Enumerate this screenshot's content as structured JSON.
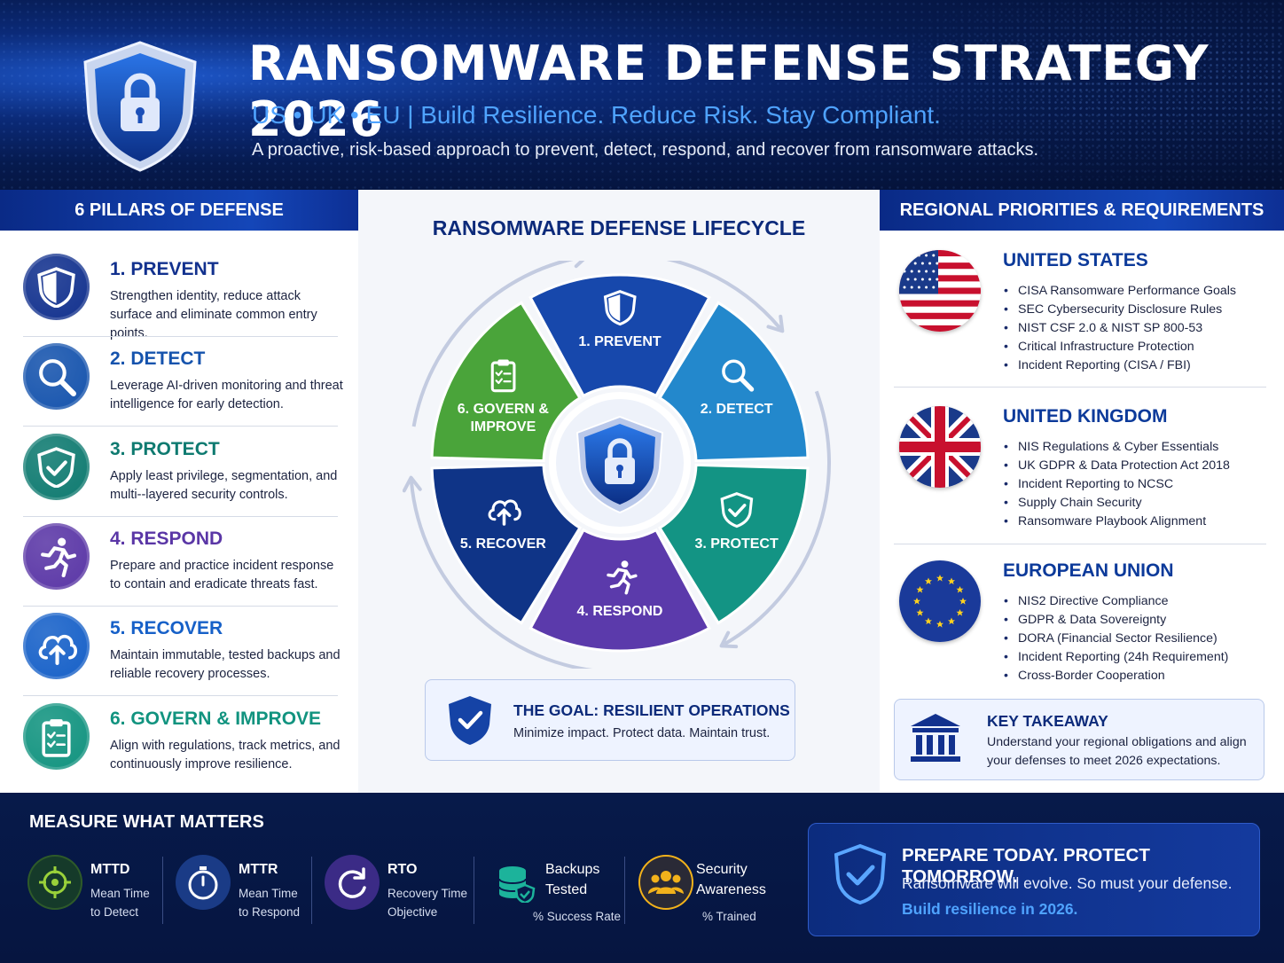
{
  "header": {
    "title": "RANSOMWARE DEFENSE STRATEGY 2026",
    "tagline": "US • UK • EU  |  Build Resilience. Reduce Risk. Stay Compliant.",
    "subtitle": "A proactive, risk-based approach to prevent, detect, respond, and recover from ransomware attacks."
  },
  "pillars": {
    "heading": "6 PILLARS OF DEFENSE",
    "items": [
      {
        "title": "1. PREVENT",
        "desc": "Strengthen identity, reduce attack surface and eliminate common entry points.",
        "icon": "shield-icon",
        "color": "#12318e"
      },
      {
        "title": "2. DETECT",
        "desc": "Leverage AI-driven monitoring and threat intelligence for early detection.",
        "icon": "magnifier-icon",
        "color": "#1553ad"
      },
      {
        "title": "3. PROTECT",
        "desc": "Apply least privilege, segmentation, and multi--layered security controls.",
        "icon": "shield-check-icon",
        "color": "#0e7a70"
      },
      {
        "title": "4. RESPOND",
        "desc": "Prepare and practice incident response to contain and eradicate threats fast.",
        "icon": "runner-icon",
        "color": "#5a36a6"
      },
      {
        "title": "5. RECOVER",
        "desc": "Maintain immutable, tested backups and reliable recovery processes.",
        "icon": "cloud-upload-icon",
        "color": "#1660c8"
      },
      {
        "title": "6. GOVERN & IMPROVE",
        "desc": "Align with regulations, track metrics, and continuously improve resilience.",
        "icon": "clipboard-icon",
        "color": "#11937f"
      }
    ]
  },
  "lifecycle": {
    "title": "RANSOMWARE DEFENSE LIFECYCLE",
    "segments": [
      {
        "label": "1. PREVENT",
        "color": "#1748ac"
      },
      {
        "label": "2. DETECT",
        "color": "#2388cc"
      },
      {
        "label": "3. PROTECT",
        "color": "#139484"
      },
      {
        "label": "4. RESPOND",
        "color": "#5b3aab"
      },
      {
        "label": "5. RECOVER",
        "color": "#0f3487"
      },
      {
        "label": "6. GOVERN &",
        "label2": "IMPROVE",
        "color": "#4aa43a"
      }
    ],
    "goal_title": "THE GOAL: RESILIENT OPERATIONS",
    "goal_text": "Minimize impact. Protect data. Maintain trust."
  },
  "regions": {
    "heading": "REGIONAL PRIORITIES & REQUIREMENTS",
    "items": [
      {
        "title": "UNITED STATES",
        "flag": "us-flag-icon",
        "bullets": [
          "CISA Ransomware Performance Goals",
          "SEC Cybersecurity Disclosure Rules",
          "NIST CSF 2.0 & NIST SP 800-53",
          "Critical Infrastructure Protection",
          "Incident Reporting (CISA / FBI)"
        ]
      },
      {
        "title": "UNITED KINGDOM",
        "flag": "uk-flag-icon",
        "bullets": [
          "NIS Regulations & Cyber Essentials",
          "UK GDPR & Data Protection Act 2018",
          "Incident Reporting to NCSC",
          "Supply Chain Security",
          "Ransomware Playbook Alignment"
        ]
      },
      {
        "title": "EUROPEAN UNION",
        "flag": "eu-flag-icon",
        "bullets": [
          "NIS2 Directive Compliance",
          "GDPR & Data Sovereignty",
          "DORA (Financial Sector Resilience)",
          "Incident Reporting (24h Requirement)",
          "Cross-Border Cooperation"
        ]
      }
    ],
    "takeaway_title": "KEY TAKEAWAY",
    "takeaway_text": "Understand your regional obligations and align your defenses to meet 2026 expectations."
  },
  "metrics": {
    "heading": "MEASURE WHAT MATTERS",
    "items": [
      {
        "name": "MTTD",
        "line1": "Mean Time",
        "line2": "to Detect",
        "icon": "target-icon",
        "color": "#7fbe2e"
      },
      {
        "name": "MTTR",
        "line1": "Mean Time",
        "line2": "to Respond",
        "icon": "stopwatch-icon",
        "color": "#3d8fe6"
      },
      {
        "name": "RTO",
        "line1": "Recovery Time",
        "line2": "Objective",
        "icon": "refresh-icon",
        "color": "#8a5de0"
      },
      {
        "name": "Backups",
        "name2": "Tested",
        "line1": "% Success Rate",
        "icon": "database-shield-icon",
        "color": "#1cb39b"
      },
      {
        "name": "Security",
        "name2": "Awareness",
        "line1": "% Trained",
        "icon": "people-icon",
        "color": "#f2b21b"
      }
    ]
  },
  "cta": {
    "title": "PREPARE TODAY. PROTECT  TOMORROW.",
    "line1": "Ransomware will evolve. So must your defense.",
    "line2": "Build resilience in 2026."
  }
}
